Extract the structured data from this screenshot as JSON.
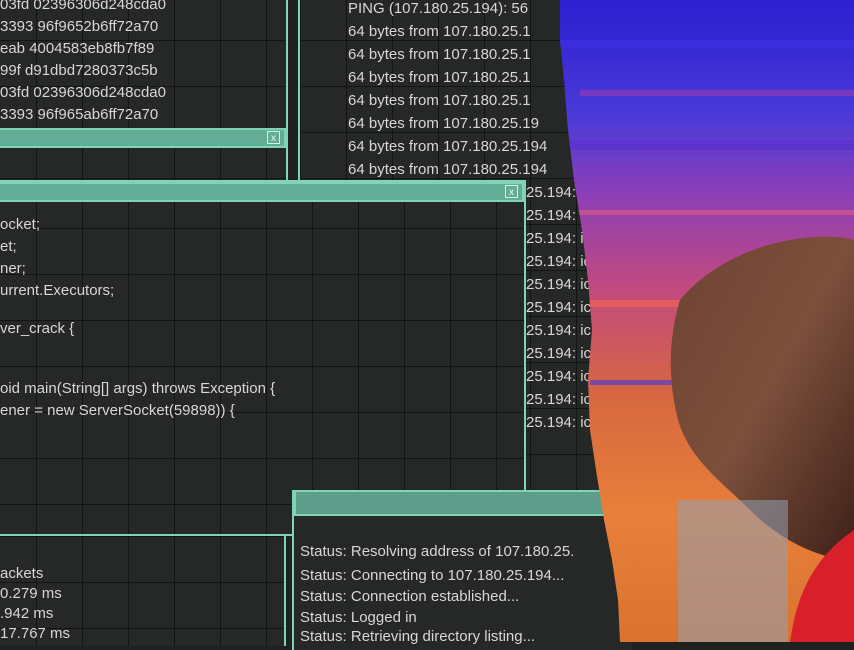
{
  "hex_window": {
    "lines": [
      "03fd 02396306d248cda0",
      "3393 96f9652b6ff72a70",
      "eab 4004583eb8fb7f89",
      "99f d91dbd7280373c5b",
      "03fd 02396306d248cda0",
      "3393 96f965ab6ff72a70"
    ],
    "close_glyph": "x"
  },
  "ping_window": {
    "lines": [
      "PING  (107.180.25.194): 56",
      "64 bytes from 107.180.25.1",
      "64 bytes from 107.180.25.1",
      "64 bytes from 107.180.25.1",
      "64 bytes from 107.180.25.1",
      "64 bytes from 107.180.25.19",
      "64 bytes from 107.180.25.194",
      "64 bytes from 107.180.25.194",
      "25.194: ic",
      "25.194: ic",
      "25.194: ic",
      "25.194: ic",
      "25.194: ic",
      "25.194: ic",
      "25.194: ic",
      "25.194: ic",
      "25.194: ic",
      "25.194: ic",
      "25.194: ic"
    ]
  },
  "code_window": {
    "close_glyph": "x",
    "lines": [
      "ocket;",
      "et;",
      "ner;",
      "urrent.Executors;",
      "",
      "ver_crack {",
      "",
      "",
      "oid main(String[] args) throws Exception {",
      "ener = new ServerSocket(59898)) {"
    ]
  },
  "stats_window": {
    "lines": [
      "ackets",
      " 0.279 ms",
      ".942 ms",
      "  17.767 ms"
    ]
  },
  "ftp_window": {
    "lines": [
      "Status: Resolving address of 107.180.25.",
      "Status: Connecting to 107.180.25.194...",
      "Status: Connection established...",
      "Status: Logged in",
      "Status: Retrieving directory listing..."
    ]
  }
}
